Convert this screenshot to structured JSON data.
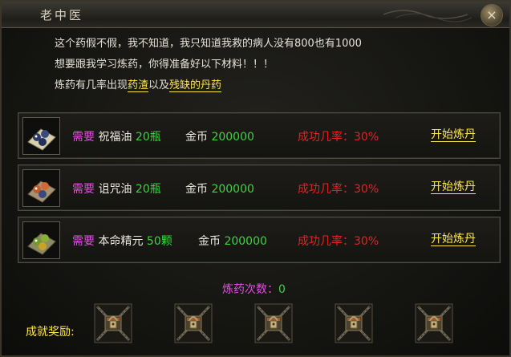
{
  "window": {
    "title": "老中医",
    "close_label": "×"
  },
  "intro": {
    "line1": "这个药假不假，我不知道，我只知道我救的病人没有800也有1000",
    "line2": "想要跟我学习炼药，你得准备好以下材料！！！",
    "line3_prefix": "炼药有几率出现",
    "link1": "药渣",
    "line3_mid": "以及",
    "link2": "残缺的丹药"
  },
  "recipes": [
    {
      "need_label": "需要",
      "item": "祝福油",
      "qty": "20瓶",
      "currency": "金币",
      "cost": "200000",
      "rate_label": "成功几率：",
      "rate": "30%",
      "button": "开始炼丹",
      "icon": "blessing-oil-icon"
    },
    {
      "need_label": "需要",
      "item": "诅咒油",
      "qty": "20瓶",
      "currency": "金币",
      "cost": "200000",
      "rate_label": "成功几率：",
      "rate": "30%",
      "button": "开始炼丹",
      "icon": "curse-oil-icon"
    },
    {
      "need_label": "需要",
      "item": "本命精元",
      "qty": "50颗",
      "currency": "金币",
      "cost": "200000",
      "rate_label": "成功几率：",
      "rate": "30%",
      "button": "开始炼丹",
      "icon": "life-essence-icon"
    }
  ],
  "counter": {
    "label": "炼药次数：",
    "value": "0"
  },
  "achievements": {
    "label": "成就奖励:",
    "count": 5,
    "icon": "locked-chest-icon"
  },
  "colors": {
    "need": "#e34ee0",
    "qty": "#3bd43b",
    "rate": "#e02424",
    "link": "#ffe74a"
  }
}
